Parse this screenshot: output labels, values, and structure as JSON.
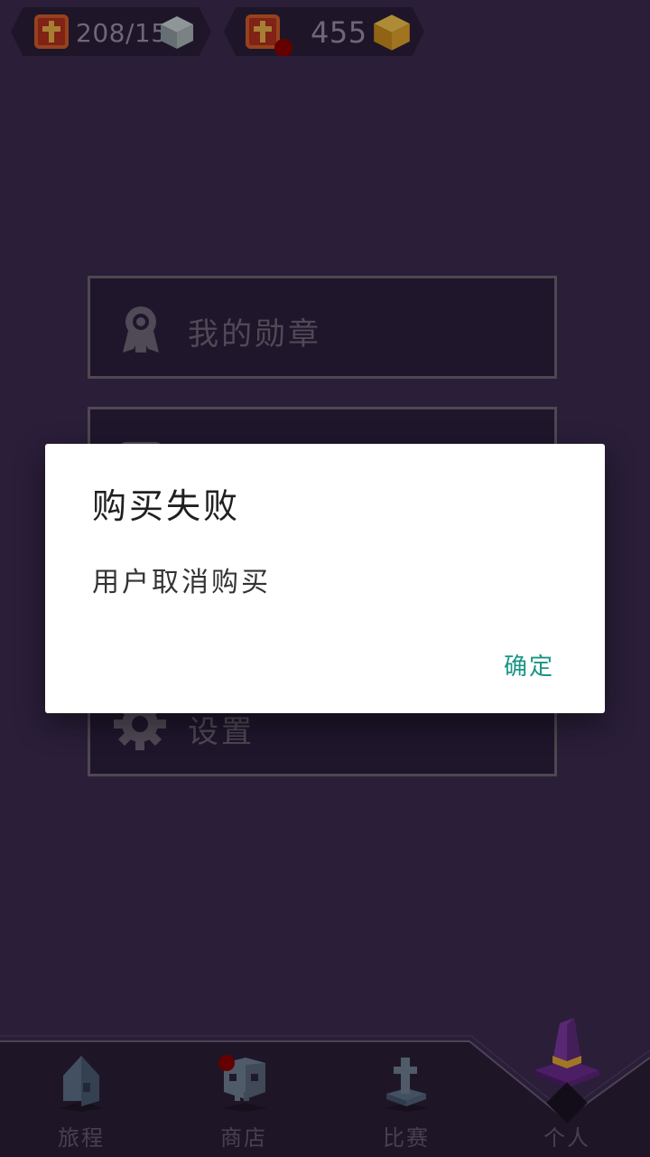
{
  "header": {
    "lives": {
      "value": "208/15",
      "icon": "cross-badge-icon",
      "cube_icon": "gray-cube-icon"
    },
    "coins": {
      "value": "455",
      "icon": "cross-badge-icon",
      "cube_icon": "gold-cube-icon",
      "has_notification": true
    }
  },
  "menu": {
    "items": [
      {
        "label": "我的勋章",
        "icon": "medal-icon"
      },
      {
        "label": "",
        "icon": ""
      },
      {
        "label": "设置",
        "icon": "gear-icon"
      }
    ]
  },
  "bottom_nav": {
    "items": [
      {
        "label": "旅程",
        "icon": "house-icon"
      },
      {
        "label": "商店",
        "icon": "skull-icon",
        "has_notification": true
      },
      {
        "label": "比赛",
        "icon": "tombstone-icon"
      },
      {
        "label": "个人",
        "icon": "witch-hat-icon",
        "active": true
      }
    ]
  },
  "dialog": {
    "title": "购买失败",
    "message": "用户取消购买",
    "confirm_label": "确定"
  },
  "colors": {
    "background": "#3b2a4f",
    "dialog_accent": "#1a9485",
    "badge_red": "#b2301e",
    "notification_red": "#8b0000"
  }
}
